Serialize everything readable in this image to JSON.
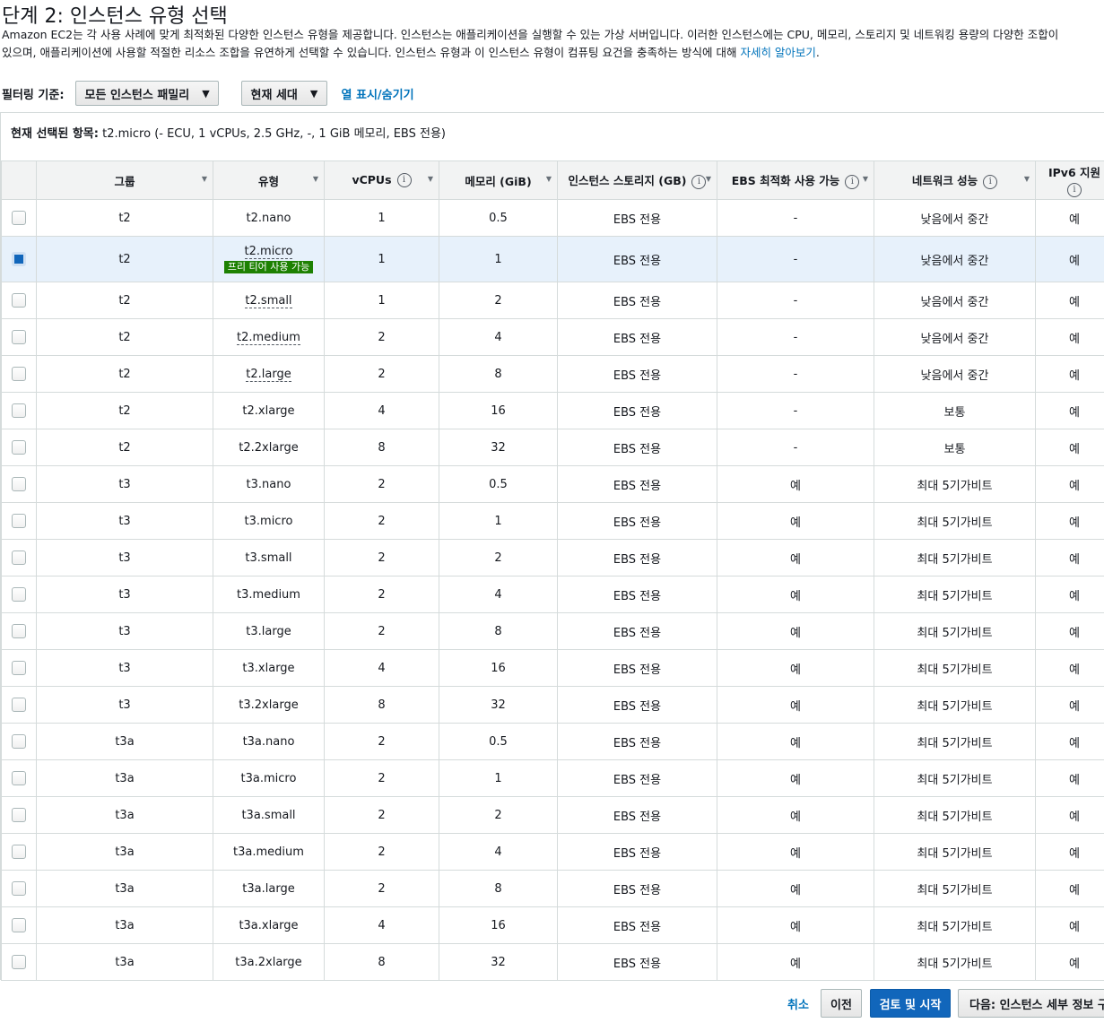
{
  "page": {
    "title": "단계 2: 인스턴스 유형 선택",
    "description_line1": "Amazon EC2는 각 사용 사례에 맞게 최적화된 다양한 인스턴스 유형을 제공합니다. 인스턴스는 애플리케이션을 실행할 수 있는 가상 서버입니다. 이러한 인스턴스에는 CPU, 메모리, 스토리지 및 네트워킹 용량의 다양한 조합이",
    "description_line2": "있으며, 애플리케이션에 사용할 적절한 리소스 조합을 유연하게 선택할 수 있습니다. 인스턴스 유형과 이 인스턴스 유형이 컴퓨팅 요건을 충족하는 방식에 대해",
    "learn_more": "자세히 알아보기",
    "learn_more_suffix": "."
  },
  "filters": {
    "label": "필터링 기준:",
    "family_value": "모든 인스턴스 패밀리",
    "generation_value": "현재 세대",
    "column_toggle": "열 표시/숨기기"
  },
  "selection": {
    "label": "현재 선택된 항목:",
    "value": "t2.micro (- ECU, 1 vCPUs, 2.5 GHz, -, 1 GiB 메모리, EBS 전용)"
  },
  "table": {
    "headers": {
      "group": "그룹",
      "type": "유형",
      "vcpus": "vCPUs",
      "memory": "메모리 (GiB)",
      "storage": "인스턴스 스토리지 (GB)",
      "ebs": "EBS 최적화 사용 가능",
      "network": "네트워크 성능",
      "ipv6": "IPv6 지원"
    },
    "free_tier_badge": "프리 티어 사용 가능",
    "rows": [
      {
        "checked": false,
        "group": "t2",
        "type": "t2.nano",
        "vcpus": "1",
        "memory": "0.5",
        "storage": "EBS 전용",
        "ebs": "-",
        "network": "낮음에서 중간",
        "ipv6": "예",
        "dashed": false,
        "free_tier": false
      },
      {
        "checked": true,
        "group": "t2",
        "type": "t2.micro",
        "vcpus": "1",
        "memory": "1",
        "storage": "EBS 전용",
        "ebs": "-",
        "network": "낮음에서 중간",
        "ipv6": "예",
        "dashed": true,
        "free_tier": true
      },
      {
        "checked": false,
        "group": "t2",
        "type": "t2.small",
        "vcpus": "1",
        "memory": "2",
        "storage": "EBS 전용",
        "ebs": "-",
        "network": "낮음에서 중간",
        "ipv6": "예",
        "dashed": true,
        "free_tier": false
      },
      {
        "checked": false,
        "group": "t2",
        "type": "t2.medium",
        "vcpus": "2",
        "memory": "4",
        "storage": "EBS 전용",
        "ebs": "-",
        "network": "낮음에서 중간",
        "ipv6": "예",
        "dashed": true,
        "free_tier": false
      },
      {
        "checked": false,
        "group": "t2",
        "type": "t2.large",
        "vcpus": "2",
        "memory": "8",
        "storage": "EBS 전용",
        "ebs": "-",
        "network": "낮음에서 중간",
        "ipv6": "예",
        "dashed": true,
        "free_tier": false
      },
      {
        "checked": false,
        "group": "t2",
        "type": "t2.xlarge",
        "vcpus": "4",
        "memory": "16",
        "storage": "EBS 전용",
        "ebs": "-",
        "network": "보통",
        "ipv6": "예",
        "dashed": false,
        "free_tier": false
      },
      {
        "checked": false,
        "group": "t2",
        "type": "t2.2xlarge",
        "vcpus": "8",
        "memory": "32",
        "storage": "EBS 전용",
        "ebs": "-",
        "network": "보통",
        "ipv6": "예",
        "dashed": false,
        "free_tier": false
      },
      {
        "checked": false,
        "group": "t3",
        "type": "t3.nano",
        "vcpus": "2",
        "memory": "0.5",
        "storage": "EBS 전용",
        "ebs": "예",
        "network": "최대 5기가비트",
        "ipv6": "예",
        "dashed": false,
        "free_tier": false
      },
      {
        "checked": false,
        "group": "t3",
        "type": "t3.micro",
        "vcpus": "2",
        "memory": "1",
        "storage": "EBS 전용",
        "ebs": "예",
        "network": "최대 5기가비트",
        "ipv6": "예",
        "dashed": false,
        "free_tier": false
      },
      {
        "checked": false,
        "group": "t3",
        "type": "t3.small",
        "vcpus": "2",
        "memory": "2",
        "storage": "EBS 전용",
        "ebs": "예",
        "network": "최대 5기가비트",
        "ipv6": "예",
        "dashed": false,
        "free_tier": false
      },
      {
        "checked": false,
        "group": "t3",
        "type": "t3.medium",
        "vcpus": "2",
        "memory": "4",
        "storage": "EBS 전용",
        "ebs": "예",
        "network": "최대 5기가비트",
        "ipv6": "예",
        "dashed": false,
        "free_tier": false
      },
      {
        "checked": false,
        "group": "t3",
        "type": "t3.large",
        "vcpus": "2",
        "memory": "8",
        "storage": "EBS 전용",
        "ebs": "예",
        "network": "최대 5기가비트",
        "ipv6": "예",
        "dashed": false,
        "free_tier": false
      },
      {
        "checked": false,
        "group": "t3",
        "type": "t3.xlarge",
        "vcpus": "4",
        "memory": "16",
        "storage": "EBS 전용",
        "ebs": "예",
        "network": "최대 5기가비트",
        "ipv6": "예",
        "dashed": false,
        "free_tier": false
      },
      {
        "checked": false,
        "group": "t3",
        "type": "t3.2xlarge",
        "vcpus": "8",
        "memory": "32",
        "storage": "EBS 전용",
        "ebs": "예",
        "network": "최대 5기가비트",
        "ipv6": "예",
        "dashed": false,
        "free_tier": false
      },
      {
        "checked": false,
        "group": "t3a",
        "type": "t3a.nano",
        "vcpus": "2",
        "memory": "0.5",
        "storage": "EBS 전용",
        "ebs": "예",
        "network": "최대 5기가비트",
        "ipv6": "예",
        "dashed": false,
        "free_tier": false
      },
      {
        "checked": false,
        "group": "t3a",
        "type": "t3a.micro",
        "vcpus": "2",
        "memory": "1",
        "storage": "EBS 전용",
        "ebs": "예",
        "network": "최대 5기가비트",
        "ipv6": "예",
        "dashed": false,
        "free_tier": false
      },
      {
        "checked": false,
        "group": "t3a",
        "type": "t3a.small",
        "vcpus": "2",
        "memory": "2",
        "storage": "EBS 전용",
        "ebs": "예",
        "network": "최대 5기가비트",
        "ipv6": "예",
        "dashed": false,
        "free_tier": false
      },
      {
        "checked": false,
        "group": "t3a",
        "type": "t3a.medium",
        "vcpus": "2",
        "memory": "4",
        "storage": "EBS 전용",
        "ebs": "예",
        "network": "최대 5기가비트",
        "ipv6": "예",
        "dashed": false,
        "free_tier": false
      },
      {
        "checked": false,
        "group": "t3a",
        "type": "t3a.large",
        "vcpus": "2",
        "memory": "8",
        "storage": "EBS 전용",
        "ebs": "예",
        "network": "최대 5기가비트",
        "ipv6": "예",
        "dashed": false,
        "free_tier": false
      },
      {
        "checked": false,
        "group": "t3a",
        "type": "t3a.xlarge",
        "vcpus": "4",
        "memory": "16",
        "storage": "EBS 전용",
        "ebs": "예",
        "network": "최대 5기가비트",
        "ipv6": "예",
        "dashed": false,
        "free_tier": false
      },
      {
        "checked": false,
        "group": "t3a",
        "type": "t3a.2xlarge",
        "vcpus": "8",
        "memory": "32",
        "storage": "EBS 전용",
        "ebs": "예",
        "network": "최대 5기가비트",
        "ipv6": "예",
        "dashed": false,
        "free_tier": false
      }
    ]
  },
  "footer": {
    "cancel": "취소",
    "previous": "이전",
    "review_launch": "검토 및 시작",
    "next": "다음: 인스턴스 세부 정보 구성"
  },
  "colors": {
    "primary_button": "#1166bb",
    "link": "#0073bb",
    "free_tier_badge": "#1d8102",
    "selected_row": "#e7f1fb"
  },
  "icons": [
    "info-icon",
    "sort-caret-icon",
    "chevron-down-icon",
    "checkbox-icon"
  ]
}
